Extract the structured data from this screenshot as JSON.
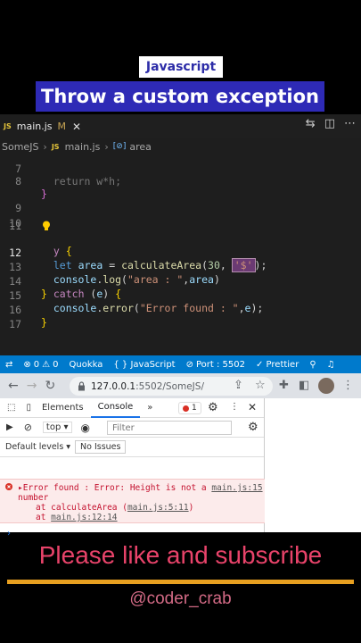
{
  "overlay": {
    "topic": "Javascript",
    "title": "Throw a custom exception",
    "cta": "Please like and subscribe",
    "handle": "@coder_crab"
  },
  "vscode": {
    "tab": {
      "icon": "JS",
      "name": "main.js",
      "modified": "M",
      "close": "✕"
    },
    "breadcrumb": {
      "folder": "SomeJS",
      "file_icon": "JS",
      "file": "main.js",
      "symbol_icon": "[⊘]",
      "symbol": "area"
    },
    "lines": [
      {
        "n": "7",
        "text": "  return w*h;"
      },
      {
        "n": "8",
        "text": "}"
      },
      {
        "n": "9",
        "text": ""
      },
      {
        "n": "10",
        "text": ""
      },
      {
        "n": "11",
        "text": "try {"
      },
      {
        "n": "12",
        "text": "  let area = calculateArea(30, '$');"
      },
      {
        "n": "13",
        "text": "  console.log(\"area : \",area)"
      },
      {
        "n": "14",
        "text": "} catch (e) {"
      },
      {
        "n": "15",
        "text": "  console.error(\"Error found : \",e);"
      },
      {
        "n": "16",
        "text": "}"
      },
      {
        "n": "17",
        "text": ""
      }
    ],
    "status": {
      "errors": "0",
      "warnings": "0",
      "quokka": "Quokka",
      "language": "{ } JavaScript",
      "port": "Port : 5502",
      "prettier": "✓ Prettier"
    }
  },
  "browser": {
    "url_host": "127.0.0.1",
    "url_path": ":5502/SomeJS/",
    "devtools": {
      "tabs": [
        "Elements",
        "Console"
      ],
      "active_tab": "Console",
      "more": "»",
      "error_count": "1",
      "context": "top",
      "filter_placeholder": "Filter",
      "levels": "Default levels ▾",
      "issues": "No Issues",
      "error": {
        "line1_prefix": "▸Error found :  Error: Height is not a ",
        "line1_link": "main.js:15",
        "line2": "number",
        "line3_prefix": "at calculateArea (",
        "line3_link": "main.js:5:11",
        "line3_suffix": ")",
        "line4_prefix": "at ",
        "line4_link": "main.js:12:14"
      },
      "prompt": "›"
    }
  },
  "colors": {
    "accent_blue": "#2e2ab6",
    "status_bar": "#007acc",
    "cta_pink": "#e8436a",
    "rule_orange": "#e8a020"
  }
}
